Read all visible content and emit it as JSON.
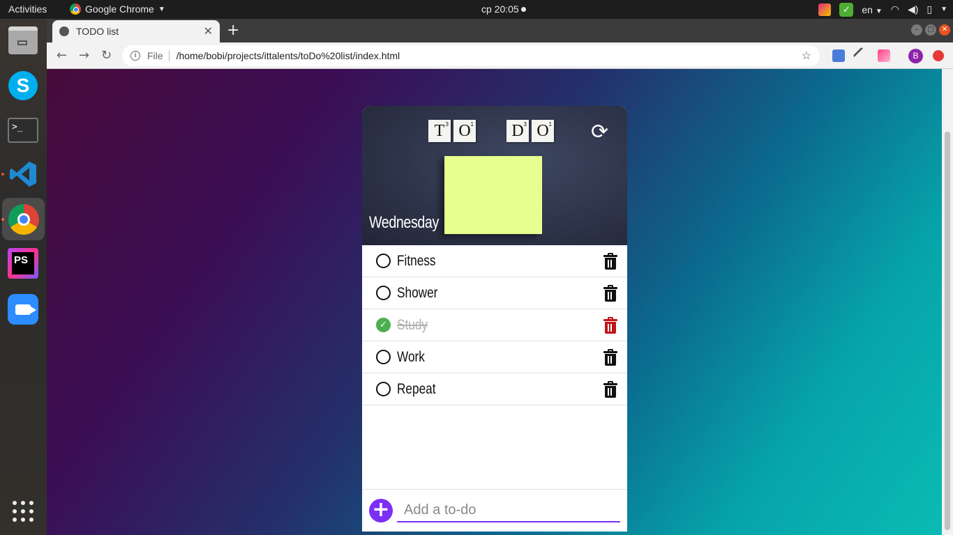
{
  "topbar": {
    "activities": "Activities",
    "app_name": "Google Chrome",
    "clock": "ср 20:05",
    "language": "en"
  },
  "dock": {
    "items": [
      "files-icon",
      "skype-icon",
      "terminal-icon",
      "vscode-icon",
      "chrome-icon",
      "phpstorm-icon",
      "zoom-icon",
      "show-apps-icon"
    ]
  },
  "browser": {
    "tab_title": "TODO list",
    "url_scheme": "File",
    "url": "/home/bobi/projects/ittalents/toDo%20list/index.html",
    "profile_initial": "B"
  },
  "todo_app": {
    "title_tiles": [
      "T",
      "O",
      "D",
      "O"
    ],
    "day": "Wednesday",
    "items": [
      {
        "text": "Fitness",
        "done": false
      },
      {
        "text": "Shower",
        "done": false
      },
      {
        "text": "Study",
        "done": true
      },
      {
        "text": "Work",
        "done": false
      },
      {
        "text": "Repeat",
        "done": false
      }
    ],
    "input_placeholder": "Add a to-do",
    "accent_color": "#7b2ff7",
    "done_color": "#4caf50",
    "delete_done_color": "#c0141a"
  }
}
